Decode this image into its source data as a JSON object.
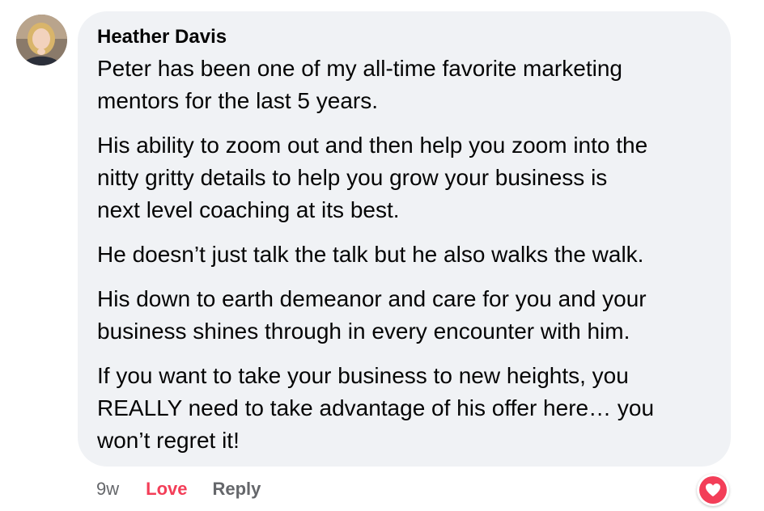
{
  "comment": {
    "author": "Heather Davis",
    "avatar_icon": "avatar-photo",
    "paragraphs": [
      [
        "Peter has been one of my all-time favorite marketing",
        "mentors for the last 5 years."
      ],
      [
        "His ability to zoom out and then help you zoom into the",
        "nitty gritty details to help you grow your business is",
        "next level coaching at its best."
      ],
      [
        "He doesn’t just talk the talk but he also walks the walk."
      ],
      [
        "His down to earth demeanor and care for you and your",
        "business shines through in every encounter with him."
      ],
      [
        "If you want to take your business to new heights, you",
        "REALLY need to take advantage of his offer here… you",
        "won’t regret it!"
      ]
    ]
  },
  "actions": {
    "timestamp": "9w",
    "love_label": "Love",
    "reply_label": "Reply"
  },
  "reaction": {
    "icon": "heart-icon",
    "color": "#f33e58"
  },
  "colors": {
    "bubble_bg": "#f0f2f5",
    "secondary_text": "#65676b",
    "love": "#f33e58"
  }
}
